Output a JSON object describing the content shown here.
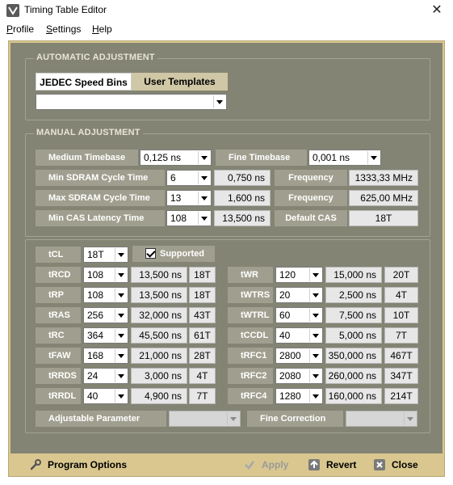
{
  "window": {
    "title": "Timing Table Editor",
    "close_glyph": "✕"
  },
  "menu": {
    "profile": "Profile",
    "settings": "Settings",
    "help": "Help"
  },
  "auto": {
    "title": "AUTOMATIC ADJUSTMENT",
    "tabs": [
      "JEDEC Speed Bins",
      "User Templates"
    ],
    "template_select": ""
  },
  "manual": {
    "title": "MANUAL ADJUSTMENT",
    "medium_timebase_label": "Medium Timebase",
    "medium_timebase_value": "0,125 ns",
    "fine_timebase_label": "Fine Timebase",
    "fine_timebase_value": "0,001 ns",
    "min_cycle_label": "Min SDRAM Cycle Time",
    "min_cycle_value": "6",
    "min_cycle_ns": "0,750 ns",
    "freq_label_1": "Frequency",
    "freq_value_1": "1333,33 MHz",
    "max_cycle_label": "Max SDRAM Cycle Time",
    "max_cycle_value": "13",
    "max_cycle_ns": "1,600 ns",
    "freq_label_2": "Frequency",
    "freq_value_2": "625,00 MHz",
    "min_cas_label": "Min CAS Latency Time",
    "min_cas_value": "108",
    "min_cas_ns": "13,500 ns",
    "default_cas_label": "Default CAS",
    "default_cas_value": "18T"
  },
  "timings": {
    "tcl_label": "tCL",
    "tcl_value": "18T",
    "supported_label": "Supported",
    "left": [
      {
        "label": "tRCD",
        "value": "108",
        "ns": "13,500 ns",
        "t": "18T"
      },
      {
        "label": "tRP",
        "value": "108",
        "ns": "13,500 ns",
        "t": "18T"
      },
      {
        "label": "tRAS",
        "value": "256",
        "ns": "32,000 ns",
        "t": "43T"
      },
      {
        "label": "tRC",
        "value": "364",
        "ns": "45,500 ns",
        "t": "61T"
      },
      {
        "label": "tFAW",
        "value": "168",
        "ns": "21,000 ns",
        "t": "28T"
      },
      {
        "label": "tRRDS",
        "value": "24",
        "ns": "3,000 ns",
        "t": "4T"
      },
      {
        "label": "tRRDL",
        "value": "40",
        "ns": "4,900 ns",
        "t": "7T"
      }
    ],
    "right": [
      {
        "label": "tWR",
        "value": "120",
        "ns": "15,000 ns",
        "t": "20T"
      },
      {
        "label": "tWTRS",
        "value": "20",
        "ns": "2,500 ns",
        "t": "4T"
      },
      {
        "label": "tWTRL",
        "value": "60",
        "ns": "7,500 ns",
        "t": "10T"
      },
      {
        "label": "tCCDL",
        "value": "40",
        "ns": "5,000 ns",
        "t": "7T"
      },
      {
        "label": "tRFC1",
        "value": "2800",
        "ns": "350,000 ns",
        "t": "467T"
      },
      {
        "label": "tRFC2",
        "value": "2080",
        "ns": "260,000 ns",
        "t": "347T"
      },
      {
        "label": "tRFC4",
        "value": "1280",
        "ns": "160,000 ns",
        "t": "214T"
      }
    ],
    "adjustable_label": "Adjustable Parameter",
    "adjustable_value": "",
    "fine_correction_label": "Fine Correction",
    "fine_correction_value": ""
  },
  "footer": {
    "program_options": "Program Options",
    "apply": "Apply",
    "revert": "Revert",
    "close": "Close"
  }
}
